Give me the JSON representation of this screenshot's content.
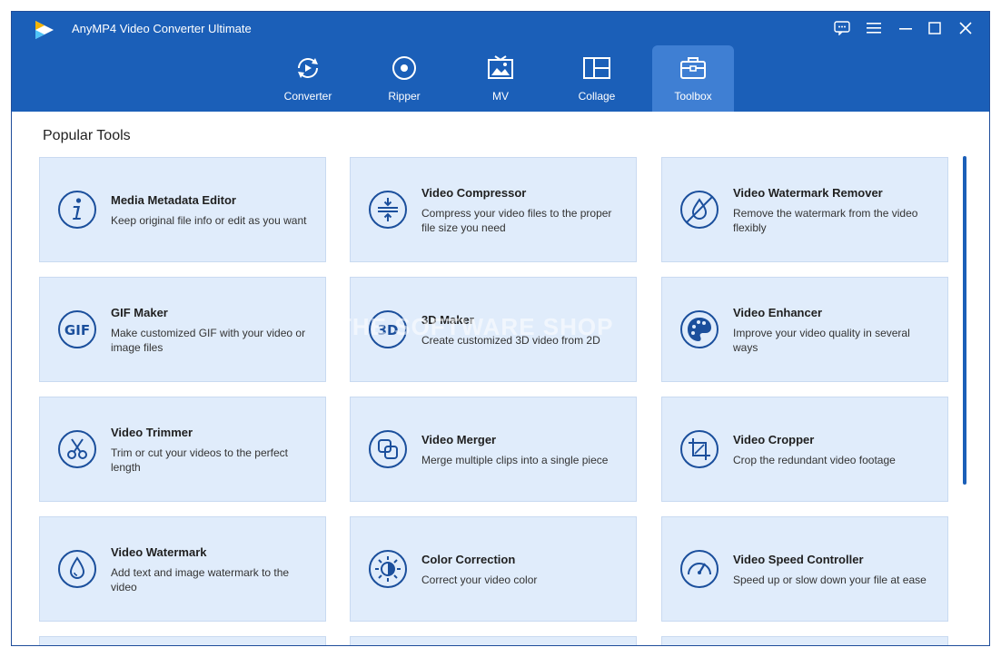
{
  "app": {
    "title": "AnyMP4 Video Converter Ultimate",
    "window_controls": [
      "feedback-icon",
      "menu-icon",
      "minimize-icon",
      "maximize-icon",
      "close-icon"
    ]
  },
  "nav": {
    "tabs": [
      {
        "label": "Converter",
        "icon": "converter-icon"
      },
      {
        "label": "Ripper",
        "icon": "ripper-icon"
      },
      {
        "label": "MV",
        "icon": "mv-icon"
      },
      {
        "label": "Collage",
        "icon": "collage-icon"
      },
      {
        "label": "Toolbox",
        "icon": "toolbox-icon",
        "active": true
      }
    ]
  },
  "section": {
    "title": "Popular Tools"
  },
  "tools": [
    {
      "title": "Media Metadata Editor",
      "desc": "Keep original file info or edit as you want",
      "icon": "info-icon"
    },
    {
      "title": "Video Compressor",
      "desc": "Compress your video files to the proper file size you need",
      "icon": "compress-icon"
    },
    {
      "title": "Video Watermark Remover",
      "desc": "Remove the watermark from the video flexibly",
      "icon": "watermark-remover-icon"
    },
    {
      "title": "GIF Maker",
      "desc": "Make customized GIF with your video or image files",
      "icon": "gif-icon"
    },
    {
      "title": "3D Maker",
      "desc": "Create customized 3D video from 2D",
      "icon": "3d-icon"
    },
    {
      "title": "Video Enhancer",
      "desc": "Improve your video quality in several ways",
      "icon": "palette-icon"
    },
    {
      "title": "Video Trimmer",
      "desc": "Trim or cut your videos to the perfect length",
      "icon": "scissors-icon"
    },
    {
      "title": "Video Merger",
      "desc": "Merge multiple clips into a single piece",
      "icon": "merge-icon"
    },
    {
      "title": "Video Cropper",
      "desc": "Crop the redundant video footage",
      "icon": "crop-icon"
    },
    {
      "title": "Video Watermark",
      "desc": "Add text and image watermark to the video",
      "icon": "droplet-icon"
    },
    {
      "title": "Color Correction",
      "desc": "Correct your video color",
      "icon": "color-correction-icon"
    },
    {
      "title": "Video Speed Controller",
      "desc": "Speed up or slow down your file at ease",
      "icon": "speedometer-icon"
    }
  ],
  "watermark_text": "THE SOFTWARE SHOP",
  "colors": {
    "titlebar": "#1b5fb8",
    "active_tab": "#3f7fd3",
    "card_bg": "#e0ecfb",
    "icon": "#1b4f9c"
  }
}
